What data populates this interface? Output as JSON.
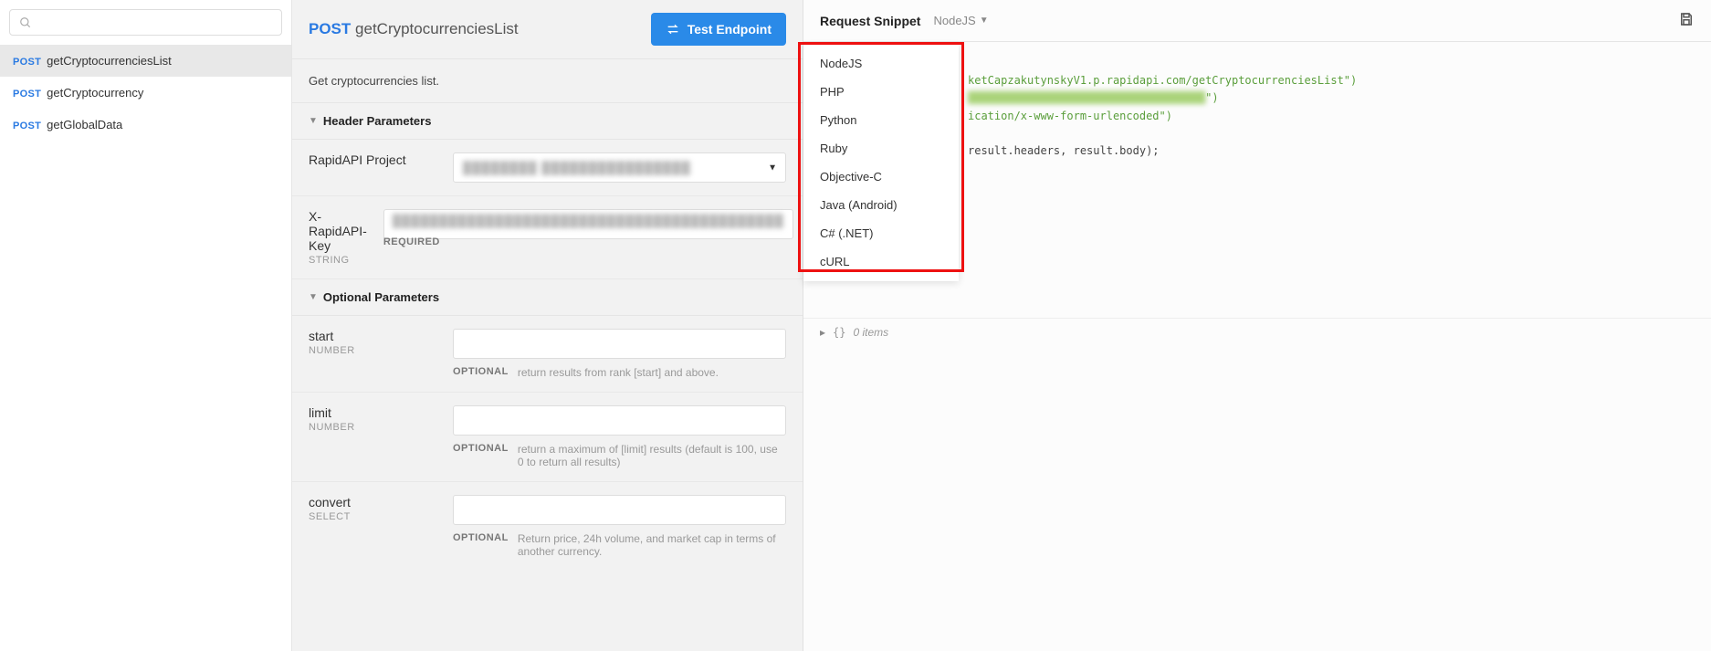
{
  "sidebar": {
    "search_placeholder": "",
    "items": [
      {
        "method": "POST",
        "name": "getCryptocurrenciesList",
        "active": true
      },
      {
        "method": "POST",
        "name": "getCryptocurrency",
        "active": false
      },
      {
        "method": "POST",
        "name": "getGlobalData",
        "active": false
      }
    ]
  },
  "header": {
    "method": "POST",
    "title": "getCryptocurrenciesList",
    "test_button": "Test Endpoint"
  },
  "description": "Get cryptocurrencies list.",
  "sections": {
    "header_params": "Header Parameters",
    "optional_params": "Optional Parameters"
  },
  "params": {
    "rapidapi_project": {
      "label": "RapidAPI Project",
      "type": "",
      "flag": "",
      "desc": ""
    },
    "api_key": {
      "label": "X-RapidAPI-Key",
      "type": "STRING",
      "flag": "REQUIRED",
      "desc": ""
    },
    "start": {
      "label": "start",
      "type": "NUMBER",
      "flag": "OPTIONAL",
      "desc": "return results from rank [start] and above."
    },
    "limit": {
      "label": "limit",
      "type": "NUMBER",
      "flag": "OPTIONAL",
      "desc": "return a maximum of [limit] results (default is 100, use 0 to return all results)"
    },
    "convert": {
      "label": "convert",
      "type": "SELECT",
      "flag": "OPTIONAL",
      "desc": "Return price, 24h volume, and market cap in terms of another currency."
    }
  },
  "right": {
    "title": "Request Snippet",
    "selected_lang": "NodeJS",
    "languages": [
      "NodeJS",
      "PHP",
      "Python",
      "Ruby",
      "Objective-C",
      "Java (Android)",
      "C# (.NET)",
      "cURL"
    ],
    "code": {
      "url_fragment": "ketCapzakutynskyV1.p.rapidapi.com/getCryptocurrenciesList\")",
      "content_type": "ication/x-www-form-urlencoded\")",
      "cb_line": "result.headers, result.body);"
    },
    "response": {
      "items_label": "0 items"
    }
  }
}
